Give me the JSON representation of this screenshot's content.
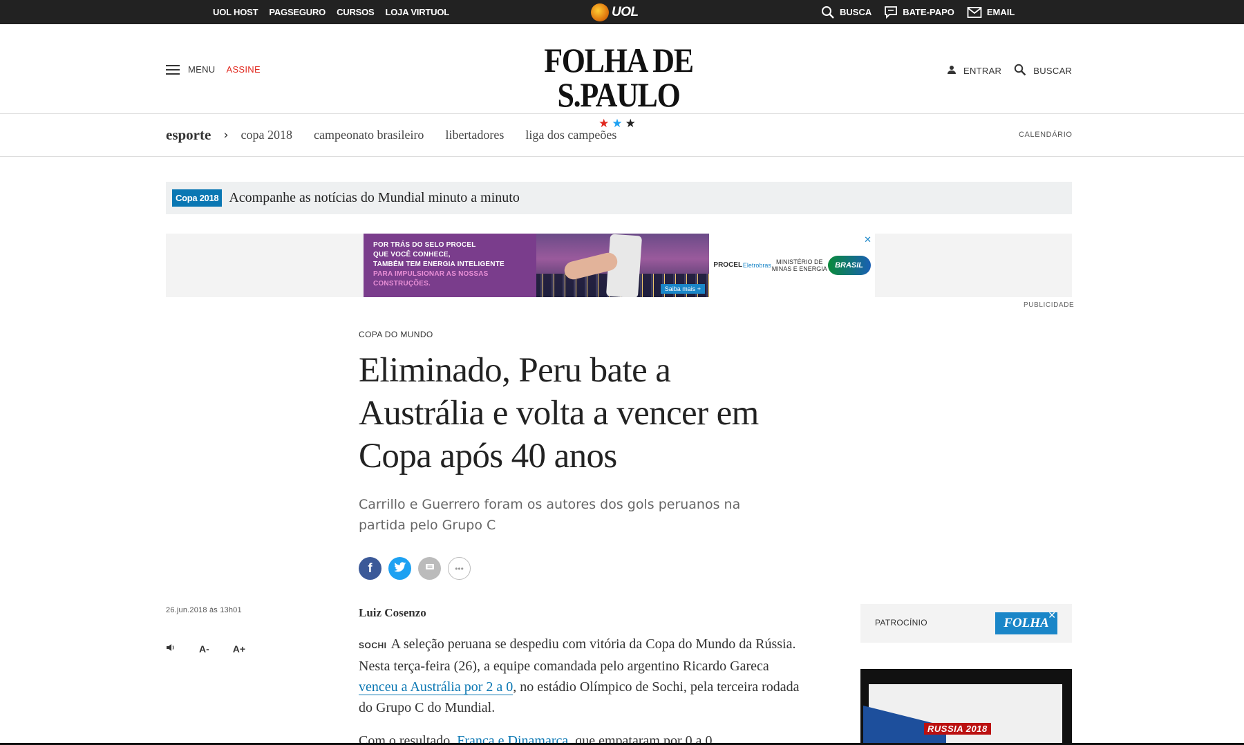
{
  "uol_bar": {
    "links": [
      "UOL HOST",
      "PAGSEGURO",
      "CURSOS",
      "LOJA VIRTUOL"
    ],
    "logo_text": "UOL",
    "busca": "BUSCA",
    "bate_papo": "BATE-PAPO",
    "email": "EMAIL"
  },
  "header": {
    "menu_label": "MENU",
    "assine_label": "ASSINE",
    "brand": "FOLHA DE S.PAULO",
    "entrar_label": "ENTRAR",
    "buscar_label": "BUSCAR",
    "star_colors": [
      "#e1291f",
      "#1da1f2",
      "#222222"
    ]
  },
  "section_nav": {
    "section": "esporte",
    "subsections": [
      "copa 2018",
      "campeonato brasileiro",
      "libertadores",
      "liga dos campeões"
    ],
    "calendar": "CALENDÁRIO"
  },
  "strip": {
    "tag": "Copa 2018",
    "text": "Acompanhe as notícias do Mundial minuto a minuto"
  },
  "ad": {
    "line1": "POR TRÁS DO SELO PROCEL",
    "line2": "QUE VOCÊ CONHECE,",
    "line3": "TAMBÉM TEM ENERGIA INTELIGENTE",
    "line4": "PARA IMPULSIONAR AS NOSSAS",
    "line5": "CONSTRUÇÕES.",
    "cta": "Saiba mais +",
    "logo_procel": "PROCEL",
    "logo_eletrobras": "Eletrobras",
    "logo_ministerio_1": "MINISTÉRIO DE",
    "logo_ministerio_2": "MINAS E ENERGIA",
    "logo_brasil": "BRASIL",
    "label": "PUBLICIDADE"
  },
  "article": {
    "kicker": "COPA DO MUNDO",
    "title": "Eliminado, Peru bate a Austrália e volta a vencer em Copa após 40 anos",
    "subtitle": "Carrillo e Guerrero foram os autores dos gols peruanos na partida pelo Grupo C",
    "date": "26.jun.2018 às 13h01",
    "font_decrease": "A-",
    "font_increase": "A+",
    "author": "Luiz Cosenzo",
    "place": "SOCHI",
    "p1_a": "A seleção peruana se despediu com vitória da Copa do Mundo da Rússia. Nesta terça-feira (26), a equipe comandada pelo argentino Ricardo Gareca ",
    "p1_link": "venceu a Austrália por 2 a 0",
    "p1_b": ", no estádio Olímpico de Sochi, pela terceira rodada do Grupo C do Mundial.",
    "p2_a": "Com o resultado, ",
    "p2_link": "França e Dinamarca",
    "p2_b": ", que empataram por 0 a 0"
  },
  "sidebar": {
    "patrocinio": "PATROCÍNIO",
    "patro_logo": "FOLHA",
    "side_ad_text": "RUSSIA 2018"
  },
  "colors": {
    "uol_bar_bg": "#222222",
    "assine": "#e1291f",
    "tag_bg": "#0a77b3",
    "link": "#0a77b3"
  }
}
